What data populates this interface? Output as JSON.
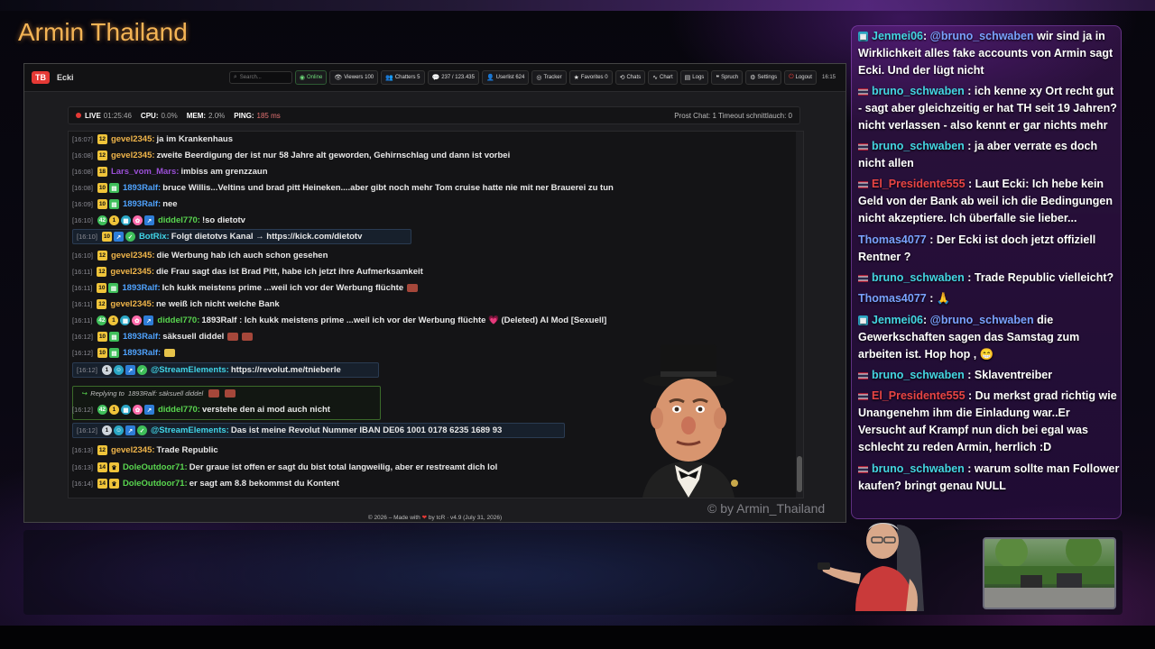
{
  "stream_title": "Armin Thailand",
  "app": {
    "name": "Ecki",
    "logo": "TB",
    "search_placeholder": "Search...",
    "nav": [
      {
        "icon": "online-icon",
        "label": "Online"
      },
      {
        "icon": "eye-icon",
        "label": "Viewers 100"
      },
      {
        "icon": "users-icon",
        "label": "Chatters 5"
      },
      {
        "icon": "chat-icon",
        "label": "237 / 123.435"
      },
      {
        "icon": "user-icon",
        "label": "Userlist 624"
      },
      {
        "icon": "tracker-icon",
        "label": "Tracker"
      },
      {
        "icon": "star-icon",
        "label": "Favorites 0"
      },
      {
        "icon": "clock-icon",
        "label": "Chats"
      },
      {
        "icon": "chart-icon",
        "label": "Chart"
      },
      {
        "icon": "logs-icon",
        "label": "Logs"
      },
      {
        "icon": "quote-icon",
        "label": "Spruch"
      },
      {
        "icon": "gear-icon",
        "label": "Settings"
      },
      {
        "icon": "logout-icon",
        "label": "Logout"
      }
    ],
    "time": "16:15"
  },
  "stats": {
    "live_label": "LIVE",
    "live_value": "01:25:46",
    "cpu_label": "CPU:",
    "cpu_value": "0.0%",
    "mem_label": "MEM:",
    "mem_value": "2.0%",
    "ping_label": "PING:",
    "ping_value": "185 ms",
    "right": "Prost Chat: 1   Timeout schnittlauch: 0"
  },
  "chat": [
    {
      "ts": "[16:07]",
      "user": "gevel2345:",
      "text": "ja im Krankenhaus"
    },
    {
      "ts": "[16:08]",
      "user": "gevel2345:",
      "text": "zweite Beerdigung der ist nur 58 Jahre alt geworden, Gehirnschlag und dann ist vorbei"
    },
    {
      "ts": "[16:08]",
      "user": "Lars_vom_Mars:",
      "text": "imbiss am grenzzaun"
    },
    {
      "ts": "[16:08]",
      "user": "1893Ralf:",
      "text": "bruce Willis...Veltins und brad pitt Heineken....aber gibt noch mehr Tom cruise hatte nie mit ner Brauerei zu tun"
    },
    {
      "ts": "[16:09]",
      "user": "1893Ralf:",
      "text": "nee"
    },
    {
      "ts": "[16:10]",
      "user": "diddel770:",
      "text": "!so dietotv"
    },
    {
      "ts": "[16:10]",
      "user": "BotRix:",
      "text": "Folgt dietotvs Kanal → https://kick.com/dietotv"
    },
    {
      "ts": "[16:10]",
      "user": "gevel2345:",
      "text": "die Werbung hab ich auch schon gesehen"
    },
    {
      "ts": "[16:11]",
      "user": "gevel2345:",
      "text": "die Frau sagt das ist Brad Pitt, habe ich jetzt ihre Aufmerksamkeit"
    },
    {
      "ts": "[16:11]",
      "user": "1893Ralf:",
      "text": "Ich kukk meistens prime ...weil ich vor der Werbung flüchte"
    },
    {
      "ts": "[16:11]",
      "user": "gevel2345:",
      "text": "ne weiß ich nicht welche Bank"
    },
    {
      "ts": "[16:11]",
      "user": "diddel770:",
      "text": "1893Ralf : Ich kukk meistens prime ...weil ich vor der Werbung flüchte 💗 (Deleted) AI Mod [Sexuell]"
    },
    {
      "ts": "[16:12]",
      "user": "1893Ralf:",
      "text": "säksuell diddel"
    },
    {
      "ts": "[16:12]",
      "user": "1893Ralf:",
      "text": ""
    },
    {
      "ts": "[16:12]",
      "user": "@StreamElements:",
      "text": "https://revolut.me/tnieberle"
    },
    {
      "ts": "[16:12]",
      "user": "diddel770:",
      "text": "verstehe den ai mod auch nicht"
    },
    {
      "ts": "[16:12]",
      "user": "@StreamElements:",
      "text": "Das ist meine Revolut Nummer IBAN DE06 1001 0178 6235 1689 93"
    },
    {
      "ts": "[16:13]",
      "user": "gevel2345:",
      "text": "Trade Republic"
    },
    {
      "ts": "[16:13]",
      "user": "DoleOutdoor71:",
      "text": "Der graue ist offen er sagt du bist total langweilig, aber er restreamt dich lol"
    },
    {
      "ts": "[16:14]",
      "user": "DoleOutdoor71:",
      "text": "er sagt am 8.8 bekommst du Kontent"
    }
  ],
  "reply_label": "Replying to",
  "reply_text": "1893Ralf: säksuell diddel",
  "footer": {
    "prefix": "© 2026 – Made with",
    "heart": "❤",
    "suffix": "by tcR · v4.9 (July 31, 2026)"
  },
  "watermark": "© by Armin_Thailand",
  "side_chat": [
    {
      "user": "Jenmei06",
      "mention": "@bruno_schwaben",
      "text": "wir sind ja in Wirklichkeit alles fake accounts von Armin sagt Ecki. Und der lügt nicht"
    },
    {
      "user": "bruno_schwaben",
      "text": ": ich kenne xy Ort recht gut - sagt aber gleichzeitig er hat TH seit 19 Jahren? nicht verlassen - also kennt er gar nichts mehr"
    },
    {
      "user": "bruno_schwaben",
      "text": ": ja aber verrate es doch nicht allen"
    },
    {
      "user": "El_Presidente555",
      "text": ": Laut Ecki: Ich hebe kein Geld von der Bank ab weil ich die Bedingungen nicht akzeptiere. Ich überfalle sie lieber..."
    },
    {
      "user": "Thomas4077",
      "text": ": Der Ecki ist doch jetzt offiziell Rentner ?"
    },
    {
      "user": "bruno_schwaben",
      "text": ": Trade Republic vielleicht?"
    },
    {
      "user": "Thomas4077",
      "text": ":"
    },
    {
      "user": "Jenmei06",
      "mention": "@bruno_schwaben",
      "text": "die Gewerkschaften sagen das Samstag zum arbeiten ist. Hop hop ,"
    },
    {
      "user": "bruno_schwaben",
      "text": ": Sklaventreiber"
    },
    {
      "user": "El_Presidente555",
      "text": ": Du merkst grad richtig wie Unangenehm ihm die Einladung war..Er Versucht auf Krampf nun dich bei egal was schlecht zu reden Armin, herrlich :D"
    },
    {
      "user": "bruno_schwaben",
      "text": ": warum sollte man Follower kaufen? bringt genau NULL"
    }
  ]
}
